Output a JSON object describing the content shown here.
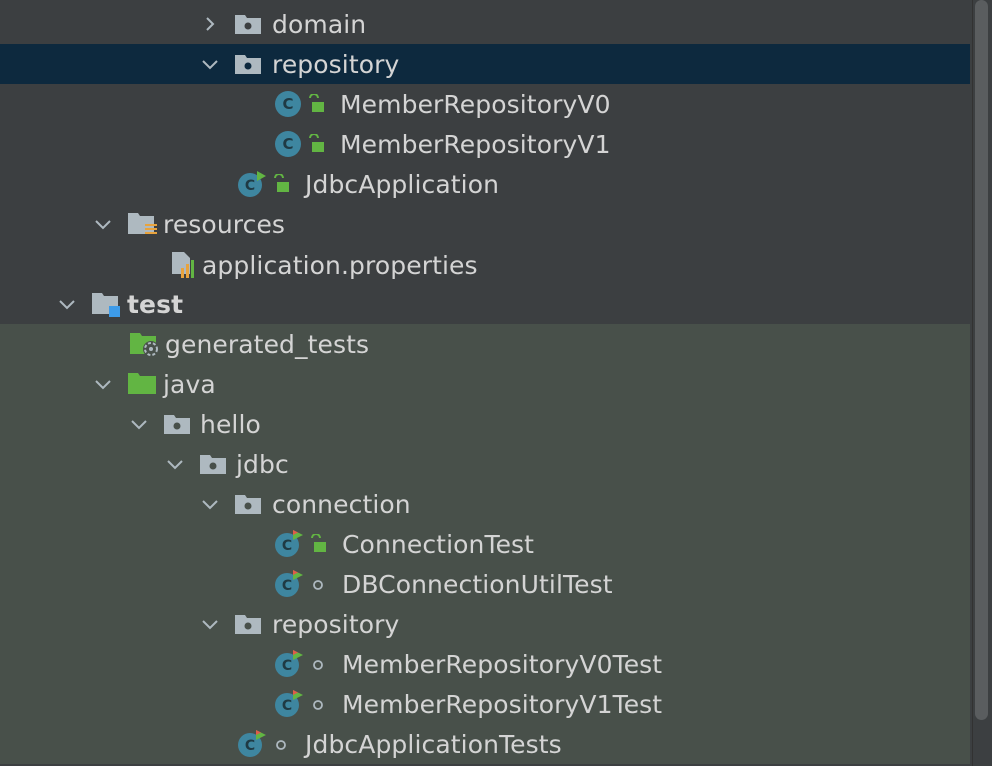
{
  "tree": {
    "domain": "domain",
    "repository_main": "repository",
    "member_v0": "MemberRepositoryV0",
    "member_v1": "MemberRepositoryV1",
    "jdbc_app": "JdbcApplication",
    "resources": "resources",
    "app_props": "application.properties",
    "test": "test",
    "generated_tests": "generated_tests",
    "java": "java",
    "hello": "hello",
    "jdbc": "jdbc",
    "connection": "connection",
    "connection_test": "ConnectionTest",
    "db_conn_util_test": "DBConnectionUtilTest",
    "repository_test": "repository",
    "member_v0_test": "MemberRepositoryV0Test",
    "member_v1_test": "MemberRepositoryV1Test",
    "jdbc_app_tests": "JdbcApplicationTests"
  },
  "colors": {
    "background": "#3c3f41",
    "selected_row": "#0d293e",
    "test_area": "#48504a",
    "class_icon": "#3e86a0",
    "folder_gray": "#aeb9c0",
    "folder_green": "#62b543",
    "lock_green": "#62b543"
  },
  "icons": {
    "chevron_right": "chevron-right-icon",
    "chevron_down": "chevron-down-icon",
    "package": "package-folder-icon",
    "class": "class-icon",
    "lock": "lock-icon",
    "dot": "package-private-dot-icon",
    "run_class": "runnable-class-icon",
    "test_class": "test-class-icon",
    "resources": "resources-folder-icon",
    "properties": "properties-file-icon",
    "test_folder": "test-folder-icon",
    "generated": "generated-folder-icon",
    "java_test": "test-source-folder-icon"
  }
}
